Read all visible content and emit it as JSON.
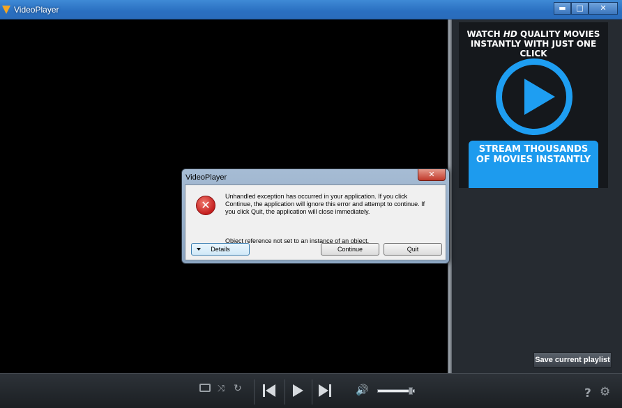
{
  "window": {
    "title": "VideoPlayer",
    "minimize_glyph": "▬",
    "maximize_glyph": "□",
    "close_glyph": "✕"
  },
  "ad": {
    "headline_prefix": "WATCH ",
    "headline_hd": "HD",
    "headline_suffix": " QUALITY MOVIES",
    "headline_line2": "INSTANTLY WITH JUST ONE CLICK",
    "cta_line1": "STREAM THOUSANDS",
    "cta_line2": "OF MOVIES INSTANTLY",
    "accent_color": "#1e9ef2"
  },
  "sidepanel": {
    "save_playlist_label": "Save current playlist"
  },
  "controls": {
    "shuffle_glyph": "⤨",
    "repeat_glyph": "↻",
    "volume_glyph": "🔊",
    "volume_level": 0.92,
    "help_glyph": "?",
    "gear_glyph": "⚙",
    "icons": [
      "tv-icon",
      "shuffle-icon",
      "repeat-icon",
      "previous-icon",
      "play-icon",
      "next-icon",
      "volume-icon",
      "help-icon",
      "settings-icon"
    ]
  },
  "dialog": {
    "title": "VideoPlayer",
    "close_glyph": "✕",
    "error_glyph": "✕",
    "message": "Unhandled exception has occurred in your application. If you click Continue, the application will ignore this error and attempt to continue. If you click Quit, the application will close immediately.",
    "detail": "Object reference not set to an instance of an object.",
    "details_label": "Details",
    "continue_label": "Continue",
    "quit_label": "Quit"
  }
}
